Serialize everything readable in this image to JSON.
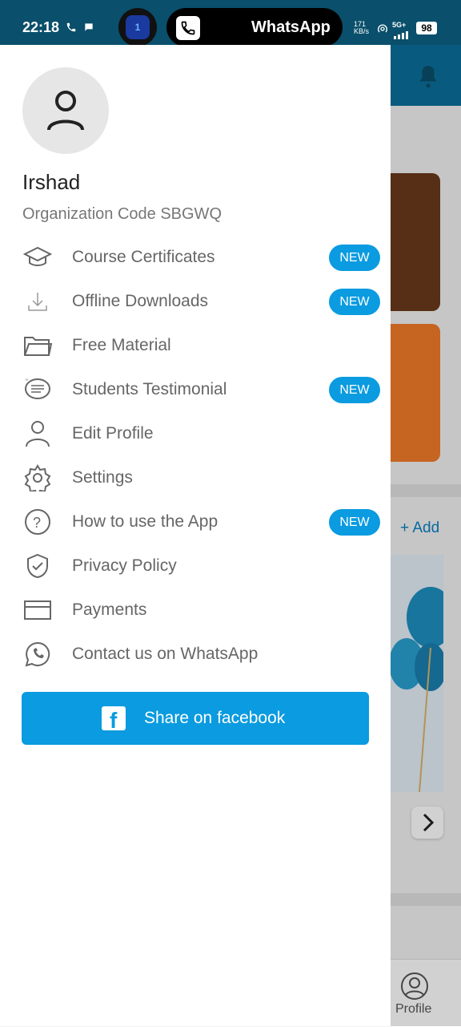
{
  "status_bar": {
    "time": "22:18",
    "island_label": "WhatsApp",
    "island_badge": "1",
    "network_speed": "171",
    "network_unit": "KB/s",
    "network_type": "5G+",
    "battery": "98"
  },
  "drawer": {
    "user_name": "Irshad",
    "organization_code": "Organization Code SBGWQ",
    "menu": [
      {
        "label": "Course Certificates",
        "icon": "graduation-cap-icon",
        "badge": "NEW"
      },
      {
        "label": "Offline Downloads",
        "icon": "download-icon",
        "badge": "NEW"
      },
      {
        "label": "Free Material",
        "icon": "folder-icon",
        "badge": ""
      },
      {
        "label": "Students Testimonial",
        "icon": "testimonial-quote-icon",
        "badge": "NEW"
      },
      {
        "label": "Edit Profile",
        "icon": "person-icon",
        "badge": ""
      },
      {
        "label": "Settings",
        "icon": "gear-icon",
        "badge": ""
      },
      {
        "label": "How to use the App",
        "icon": "help-circle-icon",
        "badge": "NEW"
      },
      {
        "label": "Privacy Policy",
        "icon": "shield-check-icon",
        "badge": ""
      },
      {
        "label": "Payments",
        "icon": "card-icon",
        "badge": ""
      },
      {
        "label": "Contact us on WhatsApp",
        "icon": "whatsapp-icon",
        "badge": ""
      }
    ],
    "share_button": "Share on facebook"
  },
  "background": {
    "add_label": "+ Add",
    "profile_label": "Profile"
  },
  "colors": {
    "status_bar": "#0a4f6b",
    "accent": "#0a9be0",
    "header_bg": "#0b6e9b"
  }
}
